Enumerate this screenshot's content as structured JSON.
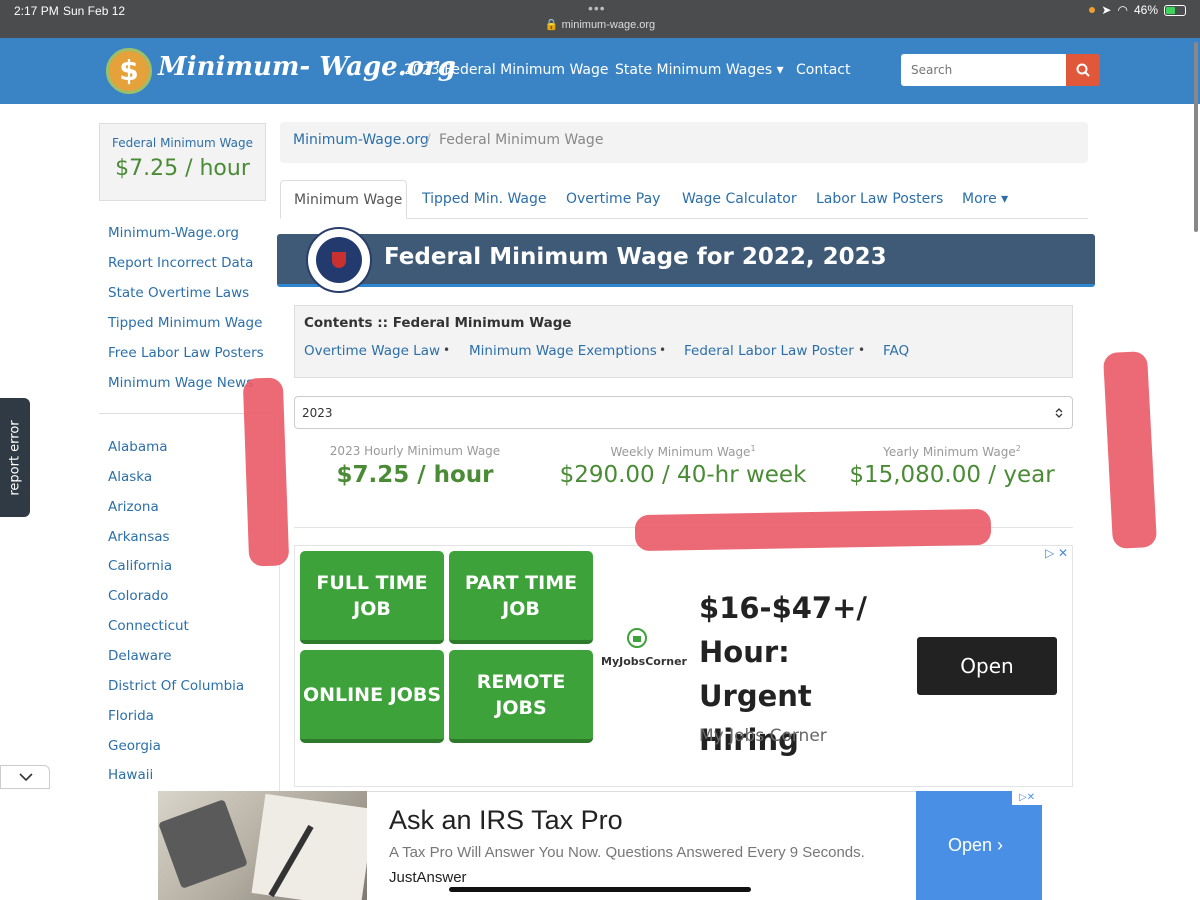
{
  "status_bar": {
    "time": "2:17 PM",
    "date": "Sun Feb 12",
    "url": "minimum-wage.org",
    "battery": "46%"
  },
  "header": {
    "brand": "Minimum- Wage.org",
    "logo_glyph": "$",
    "nav": [
      "2023 Federal Minimum Wage",
      "State Minimum Wages ▾",
      "Contact"
    ],
    "search_placeholder": "Search"
  },
  "sidebar": {
    "wage_box": {
      "label": "Federal Minimum Wage",
      "value": "$7.25 / hour"
    },
    "links": [
      "Minimum-Wage.org",
      "Report Incorrect Data",
      "State Overtime Laws",
      "Tipped Minimum Wage",
      "Free Labor Law Posters",
      "Minimum Wage News"
    ],
    "states": [
      "Alabama",
      "Alaska",
      "Arizona",
      "Arkansas",
      "California",
      "Colorado",
      "Connecticut",
      "Delaware",
      "District Of Columbia",
      "Florida",
      "Georgia",
      "Hawaii"
    ]
  },
  "report_tab": "report error",
  "breadcrumb": {
    "home": "Minimum-Wage.org",
    "separator": "/",
    "current": "Federal Minimum Wage"
  },
  "tabs": [
    "Minimum Wage",
    "Tipped Min. Wage",
    "Overtime Pay",
    "Wage Calculator",
    "Labor Law Posters",
    "More ▾"
  ],
  "banner": {
    "title_bold": "Federal",
    "title_rest": " Minimum Wage for 2022, 2023"
  },
  "contents": {
    "heading": "Contents :: Federal Minimum Wage",
    "links": [
      "Overtime Wage Law",
      "Minimum Wage Exemptions",
      "Federal Labor Law Poster",
      "FAQ"
    ],
    "bullet": "•"
  },
  "year_select": {
    "value": "2023"
  },
  "summary": [
    {
      "label": "2023 Hourly Minimum Wage",
      "sup": "",
      "value": "$7.25 / hour"
    },
    {
      "label": "Weekly Minimum Wage",
      "sup": "1",
      "value": "$290.00 / 40-hr week"
    },
    {
      "label": "Yearly Minimum Wage",
      "sup": "2",
      "value": "$15,080.00 / year"
    }
  ],
  "ad1": {
    "buttons": [
      "FULL TIME JOB",
      "PART TIME JOB",
      "ONLINE JOBS",
      "REMOTE JOBS"
    ],
    "logo_text": "MyJobsCorner",
    "headline": "$16-$47+/ Hour: Urgent Hiring",
    "advertiser": "My Jobs Corner",
    "cta": "Open",
    "corner": "▷ ✕"
  },
  "ad2": {
    "title": "Ask an IRS Tax Pro",
    "description": "A Tax Pro Will Answer You Now. Questions Answered Every 9 Seconds.",
    "brand": "JustAnswer",
    "cta": "Open ›",
    "corner": "▷✕"
  },
  "colors": {
    "nav_blue": "#3a84c6",
    "link_blue": "#2c6fa8",
    "wage_green": "#4a8b35",
    "banner": "#3f5a76",
    "job_green": "#3ea23a",
    "search_orange": "#e0573a"
  }
}
